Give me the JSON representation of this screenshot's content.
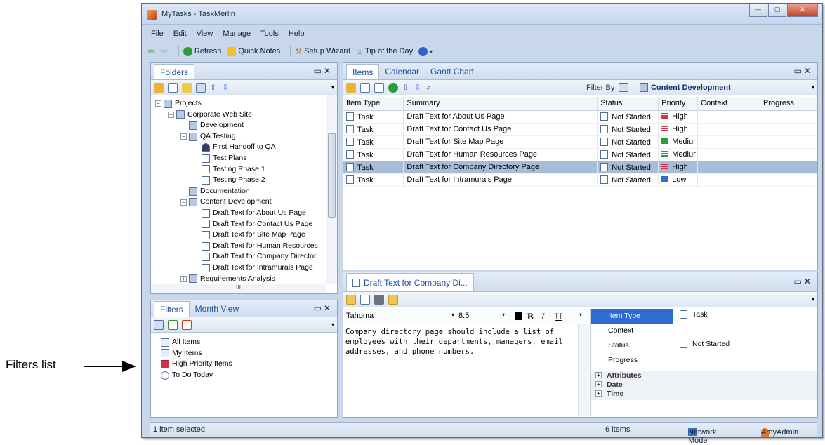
{
  "annotation": {
    "label": "Filters list"
  },
  "window": {
    "title": "MyTasks - TaskMerlin",
    "controls": [
      "minimize",
      "maximize",
      "close"
    ]
  },
  "menu": [
    "File",
    "Edit",
    "View",
    "Manage",
    "Tools",
    "Help"
  ],
  "toolbar": {
    "refresh": "Refresh",
    "quick_notes": "Quick Notes",
    "setup_wizard": "Setup Wizard",
    "tip_of_day": "Tip of the Day"
  },
  "folders_pane": {
    "tab": "Folders",
    "tree": [
      {
        "label": "Projects",
        "depth": 0,
        "icon": "project-icon",
        "expander": "−"
      },
      {
        "label": "Corporate Web Site",
        "depth": 1,
        "icon": "folder-icon",
        "expander": "−"
      },
      {
        "label": "Development",
        "depth": 2,
        "icon": "folder-icon",
        "expander": ""
      },
      {
        "label": "QA Testing",
        "depth": 2,
        "icon": "folder-icon",
        "expander": "−"
      },
      {
        "label": "First Handoff to QA",
        "depth": 3,
        "icon": "people-icon",
        "expander": ""
      },
      {
        "label": "Test Plans",
        "depth": 3,
        "icon": "doc-icon",
        "expander": ""
      },
      {
        "label": "Testing Phase 1",
        "depth": 3,
        "icon": "doc-icon",
        "expander": ""
      },
      {
        "label": "Testing Phase 2",
        "depth": 3,
        "icon": "doc-icon",
        "expander": ""
      },
      {
        "label": "Documentation",
        "depth": 2,
        "icon": "folder-icon",
        "expander": ""
      },
      {
        "label": "Content Development",
        "depth": 2,
        "icon": "folder-icon",
        "expander": "−"
      },
      {
        "label": "Draft Text for About Us Page",
        "depth": 3,
        "icon": "doc-icon",
        "expander": ""
      },
      {
        "label": "Draft Text for Contact Us Page",
        "depth": 3,
        "icon": "doc-icon",
        "expander": ""
      },
      {
        "label": "Draft Text for Site Map Page",
        "depth": 3,
        "icon": "doc-icon",
        "expander": ""
      },
      {
        "label": "Draft Text for Human Resources",
        "depth": 3,
        "icon": "doc-icon",
        "expander": ""
      },
      {
        "label": "Draft Text for Company Director",
        "depth": 3,
        "icon": "doc-icon",
        "expander": ""
      },
      {
        "label": "Draft Text for Intramurals Page",
        "depth": 3,
        "icon": "doc-icon",
        "expander": ""
      },
      {
        "label": "Requirements Analysis",
        "depth": 2,
        "icon": "folder-icon",
        "expander": "+"
      }
    ],
    "hscroll_glyph": "III"
  },
  "filters_pane": {
    "tabs": [
      "Filters",
      "Month View"
    ],
    "items": [
      {
        "label": "All Items",
        "icon": "filter-icon"
      },
      {
        "label": "My Items",
        "icon": "filter-icon"
      },
      {
        "label": "High Priority Items",
        "icon": "high-priority-icon"
      },
      {
        "label": "To Do Today",
        "icon": "clock-icon"
      }
    ]
  },
  "items_pane": {
    "tabs": [
      "Items",
      "Calendar",
      "Gantt Chart"
    ],
    "filter_by_label": "Filter By",
    "filter_value": "Content Development",
    "columns": [
      "Item Type",
      "Summary",
      "Status",
      "Priority",
      "Context",
      "Progress"
    ],
    "rows": [
      {
        "type": "Task",
        "summary": "Draft Text for About Us Page",
        "status": "Not Started",
        "priority": "High",
        "context": "",
        "progress": ""
      },
      {
        "type": "Task",
        "summary": "Draft Text for Contact Us Page",
        "status": "Not Started",
        "priority": "High",
        "context": "",
        "progress": ""
      },
      {
        "type": "Task",
        "summary": "Draft Text for Site Map Page",
        "status": "Not Started",
        "priority": "Mediur",
        "context": "",
        "progress": ""
      },
      {
        "type": "Task",
        "summary": "Draft Text for Human Resources Page",
        "status": "Not Started",
        "priority": "Mediur",
        "context": "",
        "progress": ""
      },
      {
        "type": "Task",
        "summary": "Draft Text for Company Directory Page",
        "status": "Not Started",
        "priority": "High",
        "context": "",
        "progress": ""
      },
      {
        "type": "Task",
        "summary": "Draft Text for Intramurals Page",
        "status": "Not Started",
        "priority": "Low",
        "context": "",
        "progress": ""
      }
    ],
    "selected_row": 4,
    "priority_colors": {
      "High": "#d9304a",
      "Mediur": "#2e9b3a",
      "Low": "#2e6fd1"
    }
  },
  "detail_pane": {
    "tab": "Draft Text for  Company Di...",
    "font_name": "Tahoma",
    "font_size": "8.5",
    "note": "Company directory page should include a list of employees with their departments, managers, email addresses, and phone numbers.",
    "properties": [
      {
        "name": "Item Type",
        "value": "Task"
      },
      {
        "name": "Context",
        "value": ""
      },
      {
        "name": "Status",
        "value": "Not Started"
      },
      {
        "name": "Progress",
        "value": ""
      }
    ],
    "groups": [
      "Attributes",
      "Date",
      "Time"
    ]
  },
  "statusbar": {
    "left": "1 item selected",
    "count": "6 items",
    "mode": "Network Mode",
    "user": "AmyAdmin"
  },
  "colors": {
    "window_frame": "#c8d7ea",
    "tab_text": "#1f4f9c",
    "selection": "#a7bcd8"
  }
}
